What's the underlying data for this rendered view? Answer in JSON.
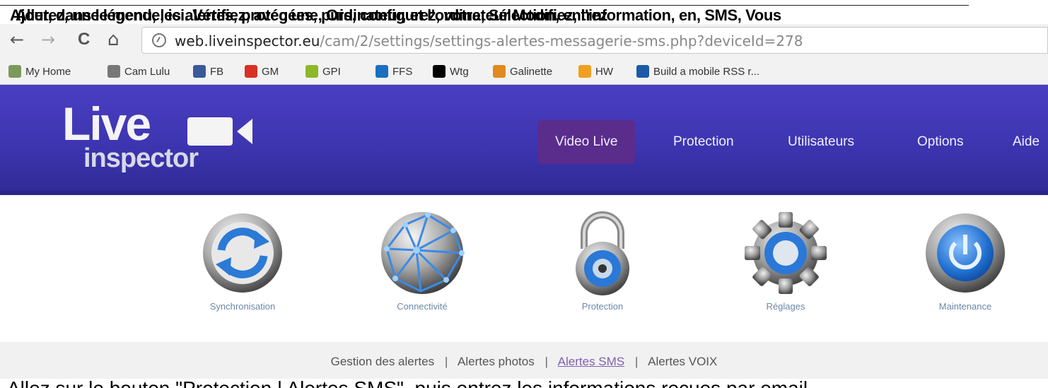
{
  "overlap_text": {
    "line_a": "Ajoutez, une légende, ici.  Vérifiez, avec une, Ordinateur, et l'ordinateur Modifiez, l'information, en, SMS, Vous",
    "line_b": "Aller, dans le menu, les alertes, protégées, puis, configurez, votre, Sélection, entrez"
  },
  "browser": {
    "back": "←",
    "forward": "→",
    "reload": "C",
    "home": "⌂",
    "url_host": "web.liveinspector.eu",
    "url_path": "/cam/2/settings/settings-alertes-messagerie-sms.php?deviceId=278"
  },
  "bookmarks": [
    {
      "label": "My Home",
      "icon": "home-icon",
      "color": "#7a9a5a"
    },
    {
      "label": "Cam Lulu",
      "icon": "globe-icon",
      "color": "#777777"
    },
    {
      "label": "FB",
      "icon": "facebook-icon",
      "color": "#3b5998"
    },
    {
      "label": "GM",
      "icon": "gmail-icon",
      "color": "#d93025"
    },
    {
      "label": "GPI",
      "icon": "leaf-icon",
      "color": "#8cb82a"
    },
    {
      "label": "FFS",
      "icon": "ffs-icon",
      "color": "#1a6fc0"
    },
    {
      "label": "Wtg",
      "icon": "wikipedia-icon",
      "color": "#000000"
    },
    {
      "label": "Galinette",
      "icon": "bird-icon",
      "color": "#e08a20"
    },
    {
      "label": "HW",
      "icon": "hw-icon",
      "color": "#f0a020"
    },
    {
      "label": "Build a mobile RSS r...",
      "icon": "ibm-icon",
      "color": "#1c5aa8"
    }
  ],
  "logo": {
    "live": "Live",
    "inspector": "inspector"
  },
  "nav": [
    {
      "label": "Video Live",
      "active": true
    },
    {
      "label": "Protection",
      "active": false
    },
    {
      "label": "Utilisateurs",
      "active": false
    },
    {
      "label": "Options",
      "active": false
    },
    {
      "label": "Aide",
      "active": false
    }
  ],
  "tools": [
    {
      "label": "Synchronisation",
      "icon": "sync-icon"
    },
    {
      "label": "Connectivité",
      "icon": "network-globe-icon"
    },
    {
      "label": "Protection",
      "icon": "padlock-icon"
    },
    {
      "label": "Réglages",
      "icon": "gear-icon"
    },
    {
      "label": "Maintenance",
      "icon": "power-icon"
    }
  ],
  "sub_menu": [
    {
      "label": "Gestion des alertes",
      "active": false
    },
    {
      "label": "Alertes photos",
      "active": false
    },
    {
      "label": "Alertes SMS",
      "active": true
    },
    {
      "label": "Alertes VOIX",
      "active": false
    }
  ],
  "sub_separator": "|",
  "bottom_text": "Allez sur le bouton \"Protection | Alertes SMS\", puis entrez les informations reçues par email",
  "colors": {
    "header": "#3d35b0",
    "nav_active": "#5a2c8c",
    "tool_label": "#6a88a6",
    "sub_active": "#8060b0"
  }
}
